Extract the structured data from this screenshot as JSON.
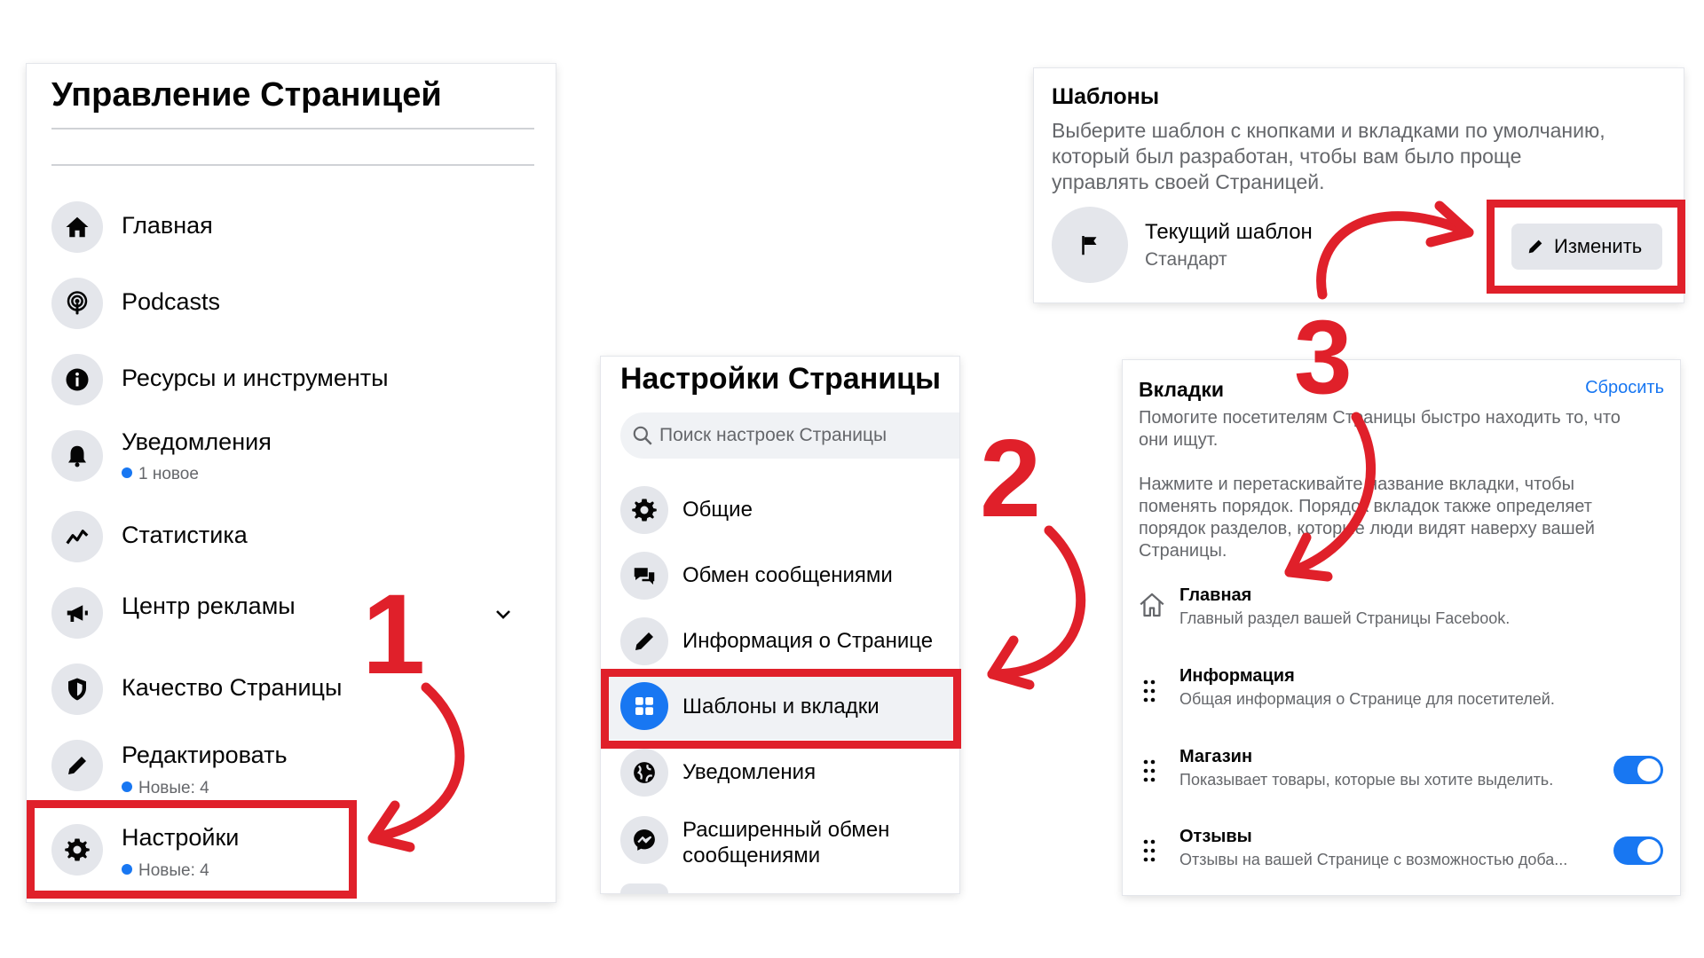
{
  "manage": {
    "title": "Управление Страницей",
    "items": [
      {
        "label": "Главная",
        "icon": "home-icon"
      },
      {
        "label": "Podcasts",
        "icon": "podcast-icon"
      },
      {
        "label": "Ресурсы и инструменты",
        "icon": "info-icon"
      },
      {
        "label": "Уведомления",
        "sub": "1 новое",
        "icon": "bell-icon"
      },
      {
        "label": "Статистика",
        "icon": "stats-icon"
      },
      {
        "label": "Центр рекламы",
        "icon": "megaphone-icon"
      },
      {
        "label": "Качество Страницы",
        "icon": "shield-icon"
      },
      {
        "label": "Редактировать",
        "sub": "Новые: 4",
        "icon": "pencil-icon"
      },
      {
        "label": "Настройки",
        "sub": "Новые: 4",
        "icon": "gear-icon"
      }
    ]
  },
  "settings": {
    "title": "Настройки Страницы",
    "search_placeholder": "Поиск настроек Страницы",
    "items": [
      {
        "label": "Общие",
        "icon": "gear-icon"
      },
      {
        "label": "Обмен сообщениями",
        "icon": "chat-icon"
      },
      {
        "label": "Информация о Странице",
        "icon": "pencil-icon"
      },
      {
        "label": "Шаблоны и вкладки",
        "icon": "grid-icon"
      },
      {
        "label": "Уведомления",
        "icon": "globe-icon"
      },
      {
        "label": "Расширенный обмен",
        "label2": "сообщениями",
        "icon": "messenger-icon"
      }
    ]
  },
  "templates": {
    "title": "Шаблоны",
    "desc1": "Выберите шаблон с кнопками и вкладками по умолчанию,",
    "desc2": "который был разработан, чтобы вам было проще",
    "desc3": "управлять своей Страницей.",
    "current_label": "Текущий шаблон",
    "current_value": "Стандарт",
    "edit_button": "Изменить"
  },
  "tabs": {
    "title": "Вкладки",
    "reset": "Сбросить",
    "desc1a": "Помогите посетителям Страницы быстро находить то, что",
    "desc1b": "они ищут.",
    "desc2a": "Нажмите и перетаскивайте название вкладки, чтобы",
    "desc2b": "поменять порядок. Порядок вкладок также определяет",
    "desc2c": "порядок разделов, которые люди видят наверху вашей",
    "desc2d": "Страницы.",
    "items": [
      {
        "name": "Главная",
        "desc": "Главный раздел вашей Страницы Facebook."
      },
      {
        "name": "Информация",
        "desc": "Общая информация о Странице для посетителей."
      },
      {
        "name": "Магазин",
        "desc": "Показывает товары, которые вы хотите выделить.",
        "enabled": true
      },
      {
        "name": "Отзывы",
        "desc": "Отзывы на вашей Странице с возможностью доба...",
        "enabled": true
      }
    ]
  },
  "steps": [
    "1",
    "2",
    "3"
  ],
  "colors": {
    "highlight": "#e0202a",
    "accent": "#1877f2"
  }
}
